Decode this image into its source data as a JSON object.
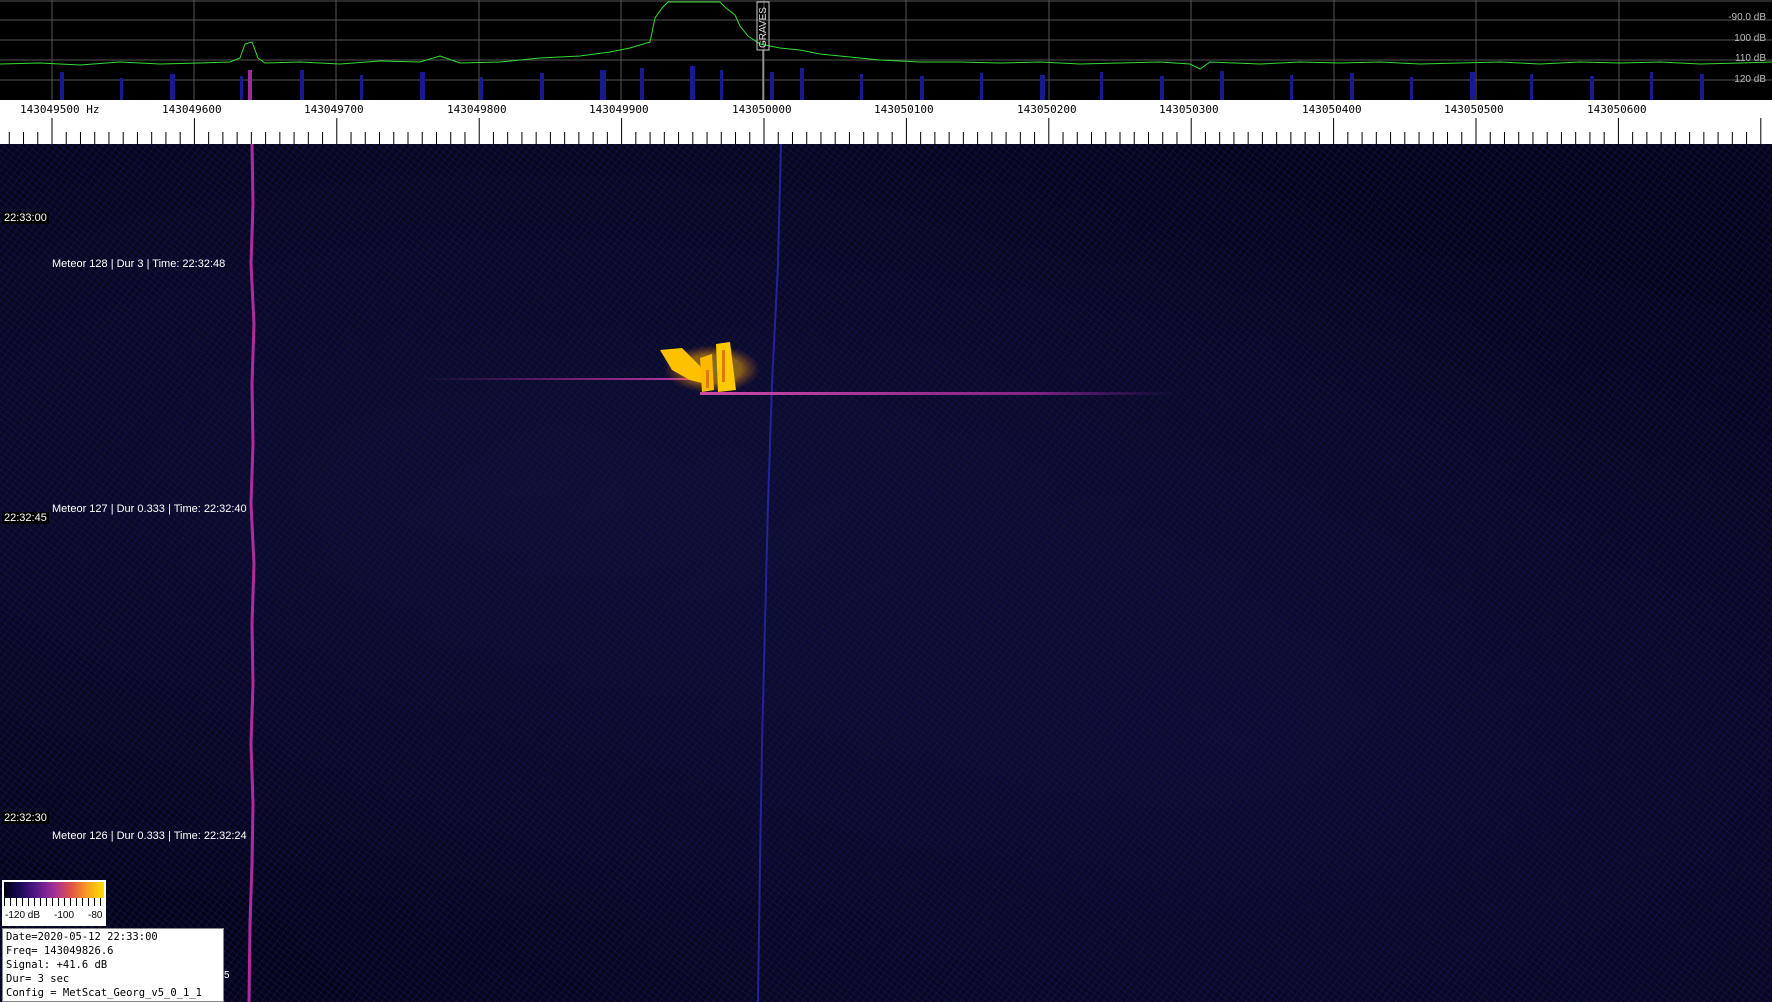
{
  "spectrum": {
    "db_labels": [
      "-90.0 dB",
      "100 dB",
      "110 dB",
      "120 dB"
    ],
    "marker_label": "GRAVES"
  },
  "ruler": {
    "freq_labels": [
      "143049500 Hz",
      "143049600",
      "143049700",
      "143049800",
      "143049900",
      "143050000",
      "143050100",
      "143050200",
      "143050300",
      "143050400",
      "143050500",
      "143050600"
    ]
  },
  "waterfall": {
    "time_labels": [
      "22:33:00",
      "22:32:45",
      "22:32:30"
    ],
    "meteors": [
      "Meteor  128 | Dur 3 | Time: 22:32:48",
      "Meteor  127 | Dur 0.333 | Time: 22:32:40",
      "Meteor  126 | Dur 0.333 | Time: 22:32:24"
    ]
  },
  "colorscale": {
    "labels": [
      "-120 dB",
      "-100",
      "-80"
    ]
  },
  "info": {
    "date": "Date=2020-05-12 22:33:00",
    "freq": "Freq= 143049826.6",
    "signal": "Signal: +41.6 dB",
    "dur": "Dur= 3 sec",
    "config": "Config = MetScat_Georg_v5_0_1_1"
  },
  "corner_number": "5",
  "colors": {
    "trace": "#33dd33",
    "carrier": "#b02aa0",
    "meteor": "#ffc000"
  }
}
